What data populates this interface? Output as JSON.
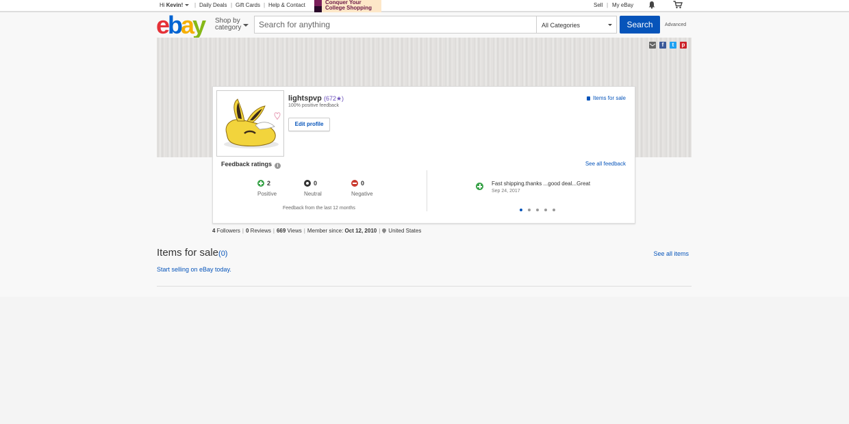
{
  "topbar": {
    "greeting_prefix": "Hi ",
    "greeting_name": "Kevin!",
    "daily_deals": "Daily Deals",
    "gift_cards": "Gift Cards",
    "help_contact": "Help & Contact",
    "promo_line1": "Conquer Your",
    "promo_line2": "College Shopping",
    "sell": "Sell",
    "my_ebay": "My eBay",
    "separator": "|"
  },
  "header": {
    "logo_letters": [
      "e",
      "b",
      "a",
      "y"
    ],
    "shop_by_line1": "Shop by",
    "shop_by_line2": "category",
    "search_placeholder": "Search for anything",
    "category_selected": "All Categories",
    "search_button": "Search",
    "advanced": "Advanced"
  },
  "profile": {
    "username": "lightspvp",
    "feedback_score": "(672",
    "feedback_star": "★)",
    "positive_feedback": "100% positive feedback",
    "edit_profile": "Edit profile",
    "items_for_sale_link": "Items for sale"
  },
  "feedback": {
    "title": "Feedback ratings",
    "info_icon": "i",
    "see_all": "See all feedback",
    "positive": {
      "count": "2",
      "label": "Positive"
    },
    "neutral": {
      "count": "0",
      "label": "Neutral"
    },
    "negative": {
      "count": "0",
      "label": "Negative"
    },
    "period": "Feedback from the last 12 months",
    "comment": "Fast shipping.thanks ...good deal...Great",
    "comment_date": "Sep 24, 2017",
    "carousel_pages": 5,
    "carousel_active": 1
  },
  "stats": {
    "followers_count": "4",
    "followers_label": " Followers",
    "reviews_count": "0",
    "reviews_label": " Reviews",
    "views_count": "669",
    "views_label": " Views",
    "member_since_label": "Member since: ",
    "member_since_date": "Oct 12, 2010",
    "location": "United States",
    "separator": "|"
  },
  "items_for_sale": {
    "title": "Items for sale",
    "count": "(0)",
    "see_all": "See all items",
    "start_selling": "Start selling on eBay today."
  },
  "share_icons": {
    "email": "email-icon",
    "facebook": "f",
    "twitter": "t",
    "pinterest": "p"
  },
  "colors": {
    "brand_blue": "#0654ba",
    "positive": "#3aa34a",
    "negative": "#c93a2f",
    "logo_e": "#e53238",
    "logo_b": "#0064d2",
    "logo_a": "#f5af02",
    "logo_y": "#86b817"
  }
}
